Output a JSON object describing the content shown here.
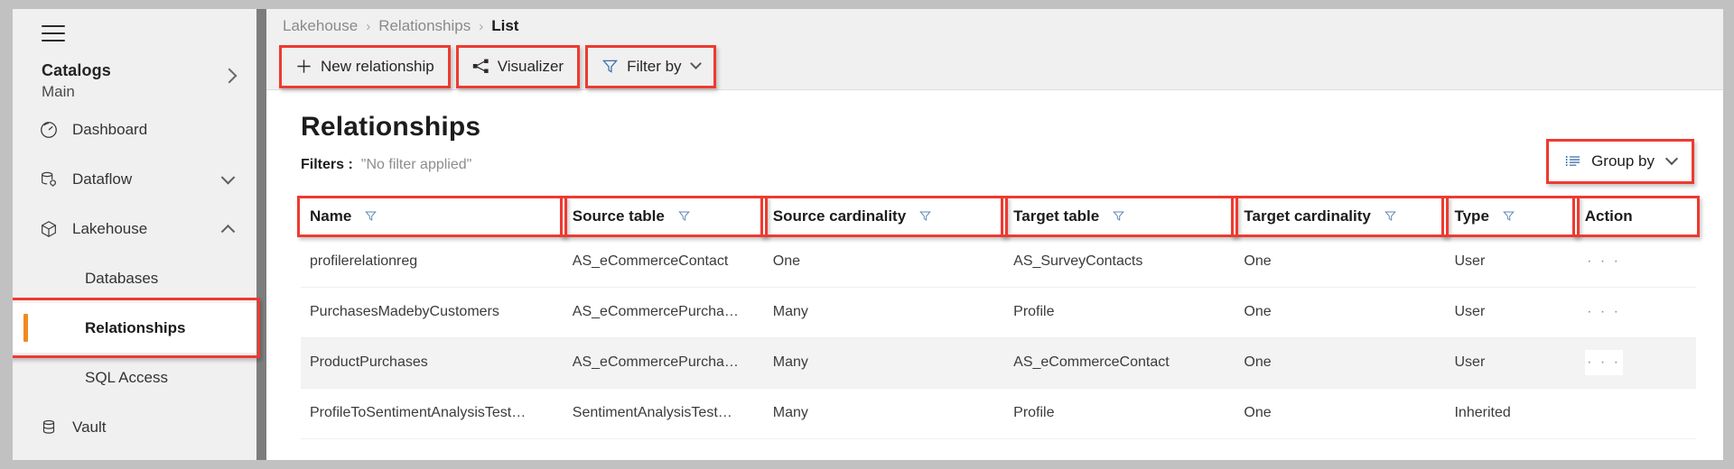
{
  "sidebar": {
    "menu_icon": "hamburger-icon",
    "catalogs": {
      "title": "Catalogs",
      "value": "Main",
      "chevron": "chevron-right-icon"
    },
    "items": [
      {
        "label": "Dashboard",
        "icon": "gauge-icon",
        "chevron": ""
      },
      {
        "label": "Dataflow",
        "icon": "database-gear-icon",
        "chevron": "chevron-down-icon"
      },
      {
        "label": "Lakehouse",
        "icon": "cube-icon",
        "chevron": "chevron-up-icon"
      },
      {
        "label": "Vault",
        "icon": "database-stack-icon",
        "chevron": ""
      }
    ],
    "lakehouse_children": [
      {
        "label": "Databases",
        "selected": false
      },
      {
        "label": "Relationships",
        "selected": true
      },
      {
        "label": "SQL Access",
        "selected": false
      }
    ],
    "accent_color": "#f18a21"
  },
  "breadcrumb": {
    "separator": "›",
    "items": [
      {
        "label": "Lakehouse",
        "current": false
      },
      {
        "label": "Relationships",
        "current": false
      },
      {
        "label": "List",
        "current": true
      }
    ]
  },
  "toolbar": {
    "new_relationship": {
      "label": "New relationship",
      "icon": "plus-icon"
    },
    "visualizer": {
      "label": "Visualizer",
      "icon": "share-nodes-icon"
    },
    "filter_by": {
      "label": "Filter by",
      "icon": "funnel-icon",
      "chevron": "chevron-down-icon"
    }
  },
  "content": {
    "page_title": "Relationships",
    "filters_label": "Filters :",
    "filters_value": "\"No filter applied\"",
    "group_by": {
      "label": "Group by",
      "icon": "list-bullet-icon",
      "chevron": "chevron-down-icon"
    }
  },
  "table": {
    "columns": [
      {
        "label": "Name",
        "filter_icon": "funnel-icon"
      },
      {
        "label": "Source table",
        "filter_icon": "funnel-icon"
      },
      {
        "label": "Source cardinality",
        "filter_icon": "funnel-icon"
      },
      {
        "label": "Target table",
        "filter_icon": "funnel-icon"
      },
      {
        "label": "Target cardinality",
        "filter_icon": "funnel-icon"
      },
      {
        "label": "Type",
        "filter_icon": "funnel-icon"
      },
      {
        "label": "Action",
        "filter_icon": ""
      }
    ],
    "rows": [
      {
        "name": "profilerelationreg",
        "source_table": "AS_eCommerceContact",
        "source_cardinality": "One",
        "target_table": "AS_SurveyContacts",
        "target_cardinality": "One",
        "type": "User",
        "action": "· · ·",
        "alt": false,
        "action_boxed": false
      },
      {
        "name": "PurchasesMadebyCustomers",
        "source_table": "AS_eCommercePurcha…",
        "source_cardinality": "Many",
        "target_table": "Profile",
        "target_cardinality": "One",
        "type": "User",
        "action": "· · ·",
        "alt": false,
        "action_boxed": false
      },
      {
        "name": "ProductPurchases",
        "source_table": "AS_eCommercePurcha…",
        "source_cardinality": "Many",
        "target_table": "AS_eCommerceContact",
        "target_cardinality": "One",
        "type": "User",
        "action": "· · ·",
        "alt": true,
        "action_boxed": true
      },
      {
        "name": "ProfileToSentimentAnalysisTest…",
        "source_table": "SentimentAnalysisTest…",
        "source_cardinality": "Many",
        "target_table": "Profile",
        "target_cardinality": "One",
        "type": "Inherited",
        "action": "",
        "alt": false,
        "action_boxed": false
      }
    ]
  },
  "annotation": {
    "color": "#ee3a30"
  }
}
